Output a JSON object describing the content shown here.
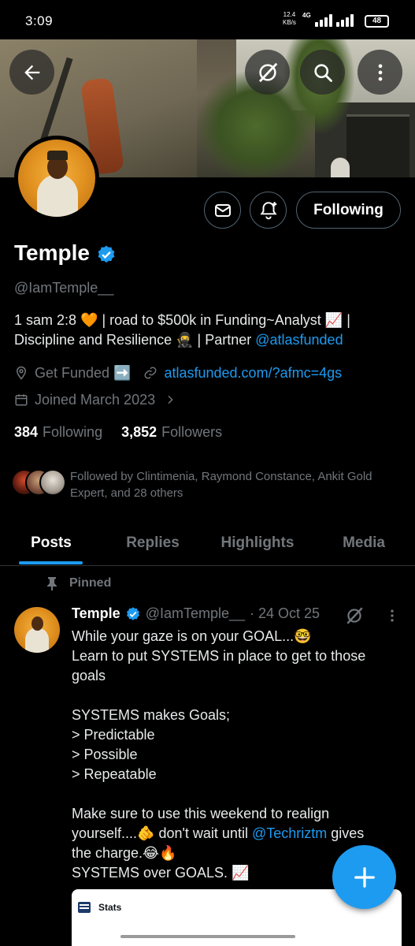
{
  "status_bar": {
    "time": "3:09",
    "speed_value": "12.4",
    "speed_unit": "KB/s",
    "network": "4G",
    "battery": "48"
  },
  "header": {
    "back_icon": "back-arrow-icon",
    "grok_icon": "grok-icon",
    "search_icon": "search-icon",
    "more_icon": "more-vertical-icon"
  },
  "profile": {
    "name": "Temple",
    "handle": "@IamTemple__",
    "bio_text": "1 sam 2:8 🧡 | road to $500k in Funding~Analyst 📈 | Discipline and Resilience 🥷 | Partner ",
    "bio_mention": "@atlasfunded",
    "location": "Get Funded ➡️",
    "website": "atlasfunded.com/?afmc=4gs",
    "joined": "Joined March 2023",
    "following_count": "384",
    "following_label": "Following",
    "followers_count": "3,852",
    "followers_label": "Followers",
    "followed_by": "Followed by Clintimenia, Raymond Constance, Ankit Gold Expert, and 28 others",
    "follow_button": "Following"
  },
  "tabs": [
    {
      "label": "Posts",
      "active": true
    },
    {
      "label": "Replies",
      "active": false
    },
    {
      "label": "Highlights",
      "active": false
    },
    {
      "label": "Media",
      "active": false
    }
  ],
  "post": {
    "pinned_label": "Pinned",
    "author": "Temple",
    "handle": "@IamTemple__",
    "date": "· 24 Oct 25",
    "text_before_mention": "While your gaze is on your GOAL...🤓\nLearn to put SYSTEMS in place to get to those goals\n\nSYSTEMS makes Goals;\n> Predictable\n> Possible\n> Repeatable\n\nMake sure to use this weekend to realign yourself....🫵 don't wait until ",
    "mention": "@Techriztm",
    "text_after_mention": " gives the charge.😂🔥\nSYSTEMS over GOALS. 📈",
    "card_title": "Stats"
  },
  "colors": {
    "accent": "#1d9bf0",
    "background": "#000000",
    "muted": "#71767b"
  }
}
